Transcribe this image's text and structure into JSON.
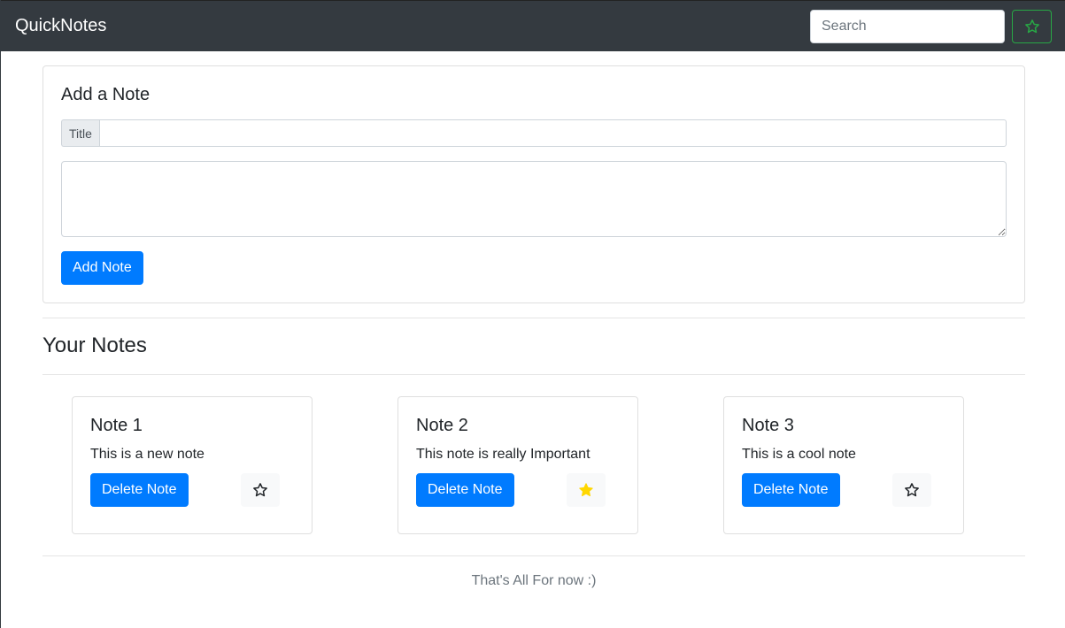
{
  "navbar": {
    "brand": "QuickNotes",
    "search_placeholder": "Search",
    "favorites_icon": "star-outline-icon",
    "favorites_color": "#28a745"
  },
  "add_note": {
    "heading": "Add a Note",
    "title_label": "Title",
    "title_value": "",
    "body_value": "",
    "submit_label": "Add Note"
  },
  "notes_section": {
    "heading": "Your Notes",
    "notes": [
      {
        "title": "Note 1",
        "text": "This is a new note",
        "delete_label": "Delete Note",
        "starred": false
      },
      {
        "title": "Note 2",
        "text": "This note is really Important",
        "delete_label": "Delete Note",
        "starred": true
      },
      {
        "title": "Note 3",
        "text": "This is a cool note",
        "delete_label": "Delete Note",
        "starred": false
      }
    ]
  },
  "footer": {
    "text": "That's All For now :)"
  },
  "colors": {
    "primary": "#007bff",
    "navbar": "#343a40",
    "star_active": "#ffd700",
    "success": "#28a745"
  }
}
